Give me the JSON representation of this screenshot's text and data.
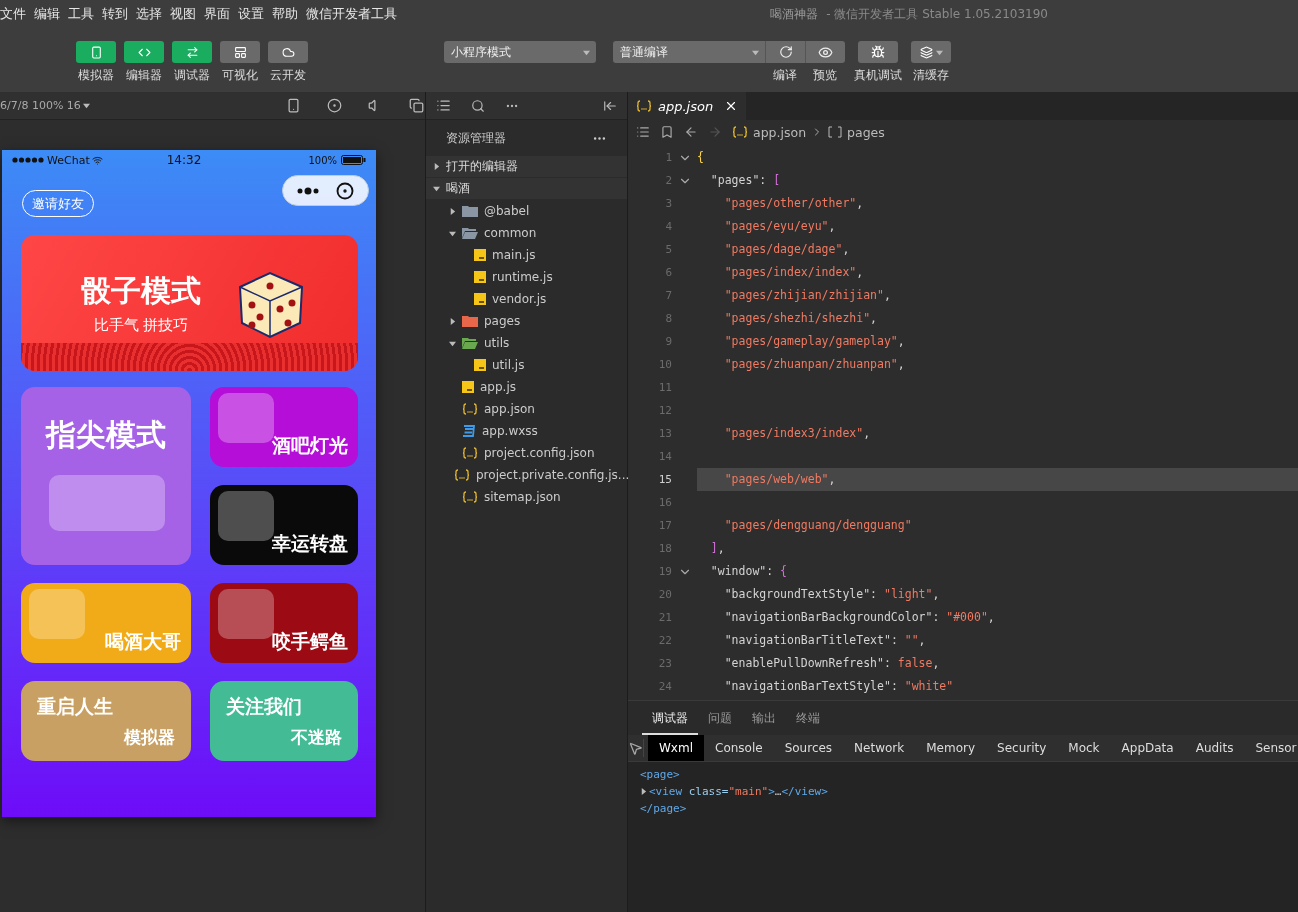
{
  "menu": [
    "文件",
    "编辑",
    "工具",
    "转到",
    "选择",
    "视图",
    "界面",
    "设置",
    "帮助",
    "微信开发者工具"
  ],
  "window": {
    "title": "喝酒神器",
    "subtitle": "- 微信开发者工具 Stable 1.05.2103190"
  },
  "toolbar": {
    "panels": [
      {
        "label": "模拟器",
        "on": true
      },
      {
        "label": "编辑器",
        "on": true
      },
      {
        "label": "调试器",
        "on": true
      },
      {
        "label": "可视化",
        "on": false
      },
      {
        "label": "云开发",
        "on": false
      }
    ],
    "mode_select": {
      "value": "小程序模式"
    },
    "compile_select": {
      "value": "普通编译"
    },
    "actions": [
      "编译",
      "预览",
      "真机调试",
      "清缓存"
    ]
  },
  "simulator": {
    "device": "6/7/8 100% 16",
    "status": {
      "carrier": "WeChat",
      "time": "14:32",
      "battery": "100%"
    },
    "invite_button": "邀请好友",
    "banner": {
      "title": "骰子模式",
      "subtitle": "比手气 拼技巧"
    },
    "cards": [
      {
        "kind": "tall",
        "title": "指尖模式",
        "color": "#a562e6"
      },
      {
        "kind": "small",
        "title": "酒吧灯光",
        "color": "#b40ed8"
      },
      {
        "kind": "small",
        "title": "幸运转盘",
        "color": "#0a0a0a"
      },
      {
        "kind": "small",
        "title": "喝酒大哥",
        "color": "#f2ab18"
      },
      {
        "kind": "small",
        "title": "咬手鳄鱼",
        "color": "#9c0b14"
      },
      {
        "kind": "text",
        "title": "重启人生",
        "subtitle": "模拟器",
        "color": "#c9a063"
      },
      {
        "kind": "text",
        "title": "关注我们",
        "subtitle": "不迷路",
        "color": "#43bb95"
      }
    ]
  },
  "explorer": {
    "title": "资源管理器",
    "sections": [
      {
        "label": "打开的编辑器",
        "expanded": false
      },
      {
        "label": "喝酒",
        "expanded": true,
        "children": [
          {
            "kind": "folder",
            "label": "@babel",
            "color": "#8a96a3",
            "expanded": false
          },
          {
            "kind": "folder",
            "label": "common",
            "color": "#8a96a3",
            "expanded": true,
            "children": [
              {
                "kind": "js",
                "label": "main.js"
              },
              {
                "kind": "js",
                "label": "runtime.js"
              },
              {
                "kind": "js",
                "label": "vendor.js"
              }
            ]
          },
          {
            "kind": "folder",
            "label": "pages",
            "color": "#e8664a",
            "expanded": false
          },
          {
            "kind": "folder",
            "label": "utils",
            "color": "#6aa84f",
            "expanded": true,
            "children": [
              {
                "kind": "js",
                "label": "util.js"
              }
            ]
          },
          {
            "kind": "js",
            "label": "app.js"
          },
          {
            "kind": "json",
            "label": "app.json"
          },
          {
            "kind": "wxss",
            "label": "app.wxss"
          },
          {
            "kind": "json",
            "label": "project.config.json"
          },
          {
            "kind": "json",
            "label": "project.private.config.js..."
          },
          {
            "kind": "json",
            "label": "sitemap.json"
          }
        ]
      }
    ]
  },
  "editor": {
    "tab": "app.json",
    "breadcrumb": [
      "app.json",
      "pages"
    ],
    "lines": [
      {
        "number": "1",
        "fold": true,
        "current": false,
        "tokens": [
          {
            "kind": "brace",
            "text": "{"
          }
        ]
      },
      {
        "number": "2",
        "fold": true,
        "current": false,
        "tokens": [
          {
            "kind": "key",
            "text": "  \"pages\""
          },
          {
            "kind": "punct",
            "text": ": "
          },
          {
            "kind": "bracket",
            "text": "["
          }
        ]
      },
      {
        "number": "3",
        "fold": false,
        "current": false,
        "tokens": [
          {
            "kind": "string",
            "text": "    \"pages/other/other\""
          },
          {
            "kind": "punct",
            "text": ","
          }
        ]
      },
      {
        "number": "4",
        "fold": false,
        "current": false,
        "tokens": [
          {
            "kind": "string",
            "text": "    \"pages/eyu/eyu\""
          },
          {
            "kind": "punct",
            "text": ","
          }
        ]
      },
      {
        "number": "5",
        "fold": false,
        "current": false,
        "tokens": [
          {
            "kind": "string",
            "text": "    \"pages/dage/dage\""
          },
          {
            "kind": "punct",
            "text": ","
          }
        ]
      },
      {
        "number": "6",
        "fold": false,
        "current": false,
        "tokens": [
          {
            "kind": "string",
            "text": "    \"pages/index/index\""
          },
          {
            "kind": "punct",
            "text": ","
          }
        ]
      },
      {
        "number": "7",
        "fold": false,
        "current": false,
        "tokens": [
          {
            "kind": "string",
            "text": "    \"pages/zhijian/zhijian\""
          },
          {
            "kind": "punct",
            "text": ","
          }
        ]
      },
      {
        "number": "8",
        "fold": false,
        "current": false,
        "tokens": [
          {
            "kind": "string",
            "text": "    \"pages/shezhi/shezhi\""
          },
          {
            "kind": "punct",
            "text": ","
          }
        ]
      },
      {
        "number": "9",
        "fold": false,
        "current": false,
        "tokens": [
          {
            "kind": "string",
            "text": "    \"pages/gameplay/gameplay\""
          },
          {
            "kind": "punct",
            "text": ","
          }
        ]
      },
      {
        "number": "10",
        "fold": false,
        "current": false,
        "tokens": [
          {
            "kind": "string",
            "text": "    \"pages/zhuanpan/zhuanpan\""
          },
          {
            "kind": "punct",
            "text": ","
          }
        ]
      },
      {
        "number": "11",
        "fold": false,
        "current": false
      },
      {
        "number": "12",
        "fold": false,
        "current": false
      },
      {
        "number": "13",
        "fold": false,
        "current": false,
        "tokens": [
          {
            "kind": "string",
            "text": "    \"pages/index3/index\""
          },
          {
            "kind": "punct",
            "text": ","
          }
        ]
      },
      {
        "number": "14",
        "fold": false,
        "current": false
      },
      {
        "number": "15",
        "fold": false,
        "current": true,
        "tokens": [
          {
            "kind": "string",
            "text": "    \"pages/web/web\""
          },
          {
            "kind": "punct",
            "text": ","
          }
        ]
      },
      {
        "number": "16",
        "fold": false,
        "current": false
      },
      {
        "number": "17",
        "fold": false,
        "current": false,
        "tokens": [
          {
            "kind": "string",
            "text": "    \"pages/dengguang/dengguang\""
          }
        ]
      },
      {
        "number": "18",
        "fold": false,
        "current": false,
        "tokens": [
          {
            "kind": "bracket",
            "text": "  ]"
          },
          {
            "kind": "punct",
            "text": ","
          }
        ]
      },
      {
        "number": "19",
        "fold": true,
        "current": false,
        "tokens": [
          {
            "kind": "key",
            "text": "  \"window\""
          },
          {
            "kind": "punct",
            "text": ": "
          },
          {
            "kind": "bracket",
            "text": "{"
          }
        ]
      },
      {
        "number": "20",
        "fold": false,
        "current": false,
        "tokens": [
          {
            "kind": "key",
            "text": "    \"backgroundTextStyle\""
          },
          {
            "kind": "punct",
            "text": ": "
          },
          {
            "kind": "string",
            "text": "\"light\""
          },
          {
            "kind": "punct",
            "text": ","
          }
        ]
      },
      {
        "number": "21",
        "fold": false,
        "current": false,
        "tokens": [
          {
            "kind": "key",
            "text": "    \"navigationBarBackgroundColor\""
          },
          {
            "kind": "punct",
            "text": ": "
          },
          {
            "kind": "string",
            "text": "\"#000\""
          },
          {
            "kind": "punct",
            "text": ","
          }
        ]
      },
      {
        "number": "22",
        "fold": false,
        "current": false,
        "tokens": [
          {
            "kind": "key",
            "text": "    \"navigationBarTitleText\""
          },
          {
            "kind": "punct",
            "text": ": "
          },
          {
            "kind": "string",
            "text": "\"\""
          },
          {
            "kind": "punct",
            "text": ","
          }
        ]
      },
      {
        "number": "23",
        "fold": false,
        "current": false,
        "tokens": [
          {
            "kind": "key",
            "text": "    \"enablePullDownRefresh\""
          },
          {
            "kind": "punct",
            "text": ": "
          },
          {
            "kind": "literal",
            "text": "false"
          },
          {
            "kind": "punct",
            "text": ","
          }
        ]
      },
      {
        "number": "24",
        "fold": false,
        "current": false,
        "tokens": [
          {
            "kind": "key",
            "text": "    \"navigationBarTextStyle\""
          },
          {
            "kind": "punct",
            "text": ": "
          },
          {
            "kind": "string",
            "text": "\"white\""
          }
        ]
      }
    ]
  },
  "debug_panel": {
    "tabs": [
      {
        "label": "调试器",
        "selected": true
      },
      {
        "label": "问题",
        "selected": false
      },
      {
        "label": "输出",
        "selected": false
      },
      {
        "label": "终端",
        "selected": false
      }
    ],
    "devtools_tabs": [
      {
        "label": "Wxml",
        "selected": true
      },
      {
        "label": "Console",
        "selected": false
      },
      {
        "label": "Sources",
        "selected": false
      },
      {
        "label": "Network",
        "selected": false
      },
      {
        "label": "Memory",
        "selected": false
      },
      {
        "label": "Security",
        "selected": false
      },
      {
        "label": "Mock",
        "selected": false
      },
      {
        "label": "AppData",
        "selected": false
      },
      {
        "label": "Audits",
        "selected": false
      },
      {
        "label": "Sensor",
        "selected": false
      }
    ],
    "wxml": [
      {
        "kind": "tag",
        "tokens": [
          {
            "kind": "tag",
            "text": "<page>"
          }
        ]
      },
      {
        "kind": "element",
        "tokens": [
          {
            "kind": "tag",
            "text": "<view"
          },
          {
            "kind": "attr",
            "text": " class="
          },
          {
            "kind": "value",
            "text": "\"main\""
          },
          {
            "kind": "tag",
            "text": ">"
          },
          {
            "kind": "text",
            "text": "…"
          },
          {
            "kind": "tag",
            "text": "</view>"
          }
        ]
      },
      {
        "kind": "tag",
        "tokens": [
          {
            "kind": "tag",
            "text": "</page>"
          }
        ]
      }
    ]
  }
}
